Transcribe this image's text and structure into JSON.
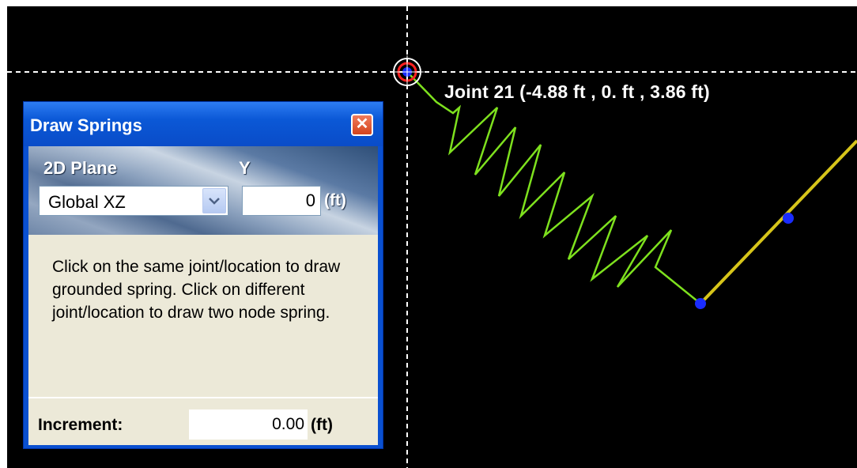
{
  "viewport": {
    "joint_label": "Joint 21 (-4.88 ft , 0. ft , 3.86 ft)",
    "colors": {
      "background": "#000000",
      "spring": "#7ee11e",
      "member": "#d7c51a",
      "joint": "#1a2cff",
      "snap_outer": "#ff2020",
      "crosshair": "#ffffff"
    }
  },
  "dialog": {
    "title": "Draw Springs",
    "close_icon": "close-x-icon",
    "plane_label": "2D Plane",
    "y_label": "Y",
    "plane_value": "Global XZ",
    "y_value": "0",
    "y_unit": "(ft)",
    "instructions": "Click on the same joint/location to draw grounded spring. Click on different joint/location to draw two node spring.",
    "increment_label": "Increment:",
    "increment_value": "0.00",
    "increment_unit": "(ft)"
  }
}
